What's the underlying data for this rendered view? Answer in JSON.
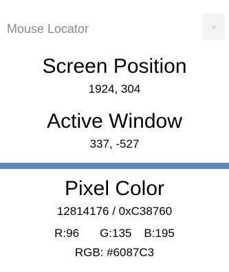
{
  "window": {
    "title": "Mouse Locator",
    "close_glyph": "×"
  },
  "screen": {
    "heading": "Screen Position",
    "value": "1924, 304"
  },
  "active_window": {
    "heading": "Active Window",
    "value": "337, -527"
  },
  "pixel": {
    "heading": "Pixel Color",
    "decimal_hex": "12814176 / 0xC38760",
    "r_label": "R:96",
    "g_label": "G:135",
    "b_label": "B:195",
    "rgb_hex": "RGB: #6087C3"
  },
  "colors": {
    "swatch": "#6087C3",
    "title_text": "#8a8a8a"
  },
  "icons": {
    "close": "close-icon"
  }
}
